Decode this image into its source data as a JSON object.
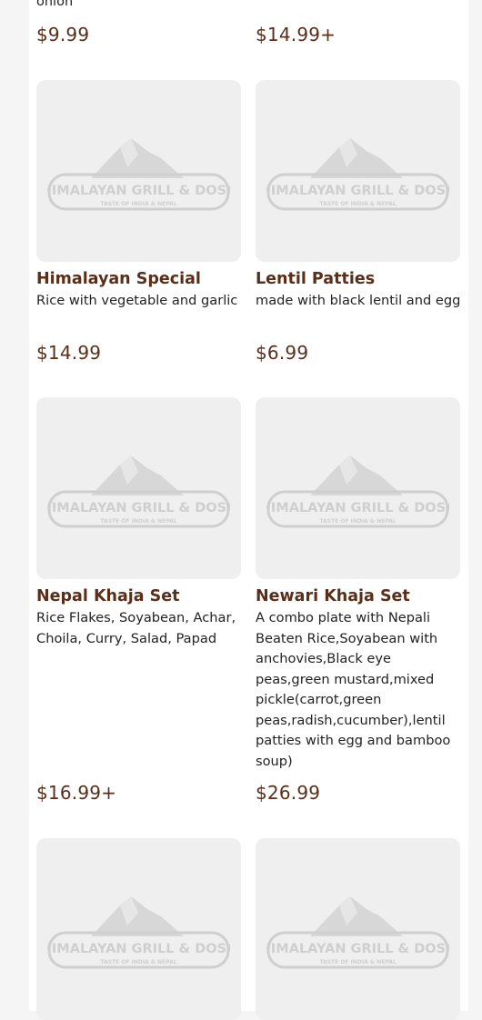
{
  "partial_top": {
    "left_desc": "onion",
    "left_price": "$9.99",
    "right_price": "$14.99+"
  },
  "logo": {
    "brand": "HIMALAYAN GRILL & DOSA",
    "tagline": "TASTE OF INDIA & NEPAL"
  },
  "items": [
    {
      "name": "Himalayan Special",
      "description": "Rice with vegetable and garlic",
      "price": "$14.99"
    },
    {
      "name": "Lentil Patties",
      "description": "made with black lentil and egg",
      "price": "$6.99"
    },
    {
      "name": "Nepal Khaja Set",
      "description": "Rice Flakes, Soyabean, Achar, Choila, Curry, Salad, Papad",
      "price": "$16.99+"
    },
    {
      "name": "Newari Khaja Set",
      "description": "A combo plate with Nepali Beaten Rice,Soyabean with anchovies,Black eye peas,green mustard,mixed pickle(carrot,green peas,radish,cucumber),lentil patties with egg and bamboo soup)",
      "price": "$26.99"
    }
  ],
  "colors": {
    "accent": "#5a2f1a",
    "placeholder_bg": "#efefef",
    "logo_gray": "#cfcfcf"
  }
}
